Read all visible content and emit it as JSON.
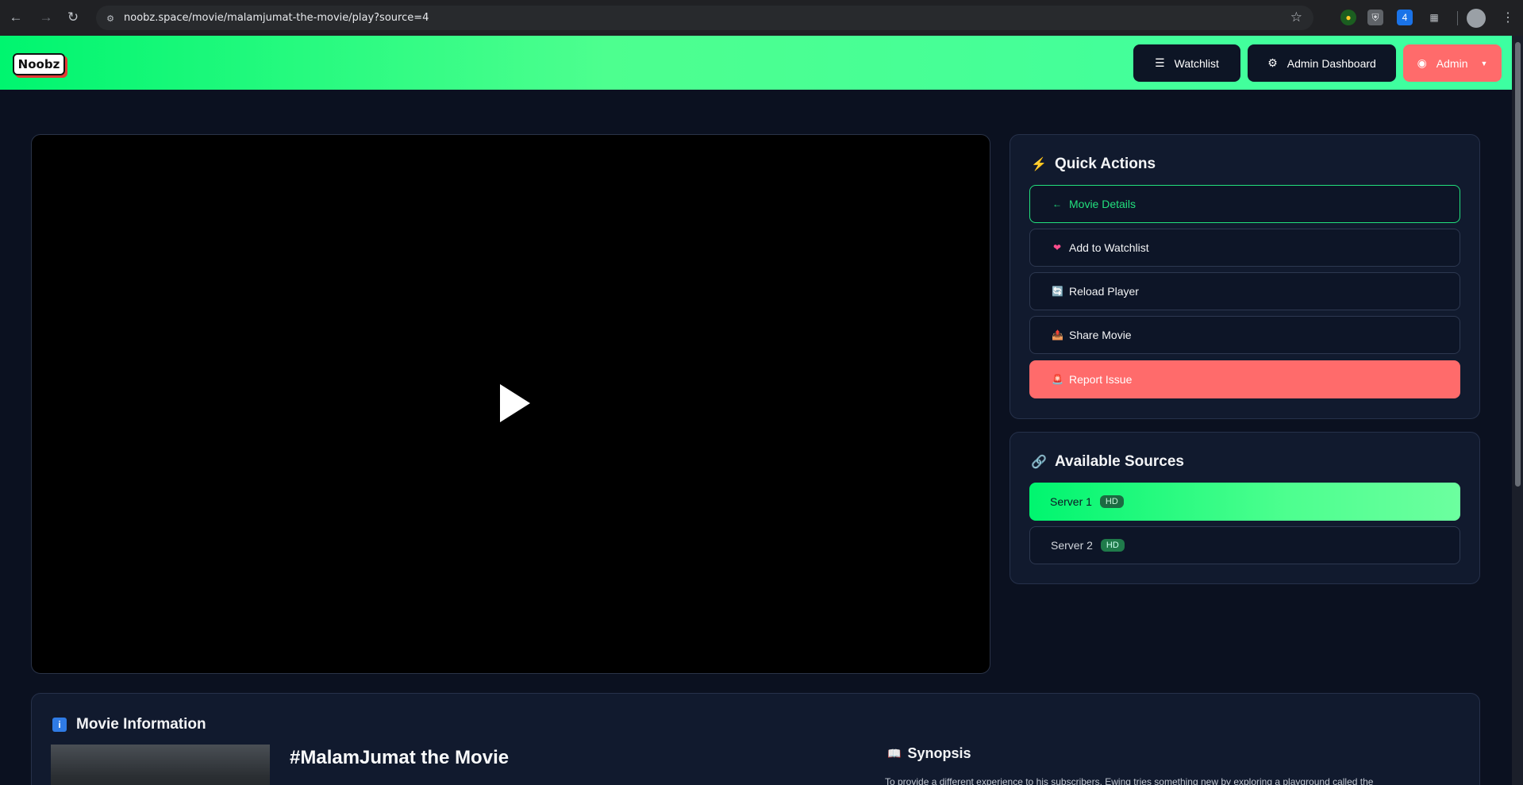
{
  "browser": {
    "url": "noobz.space/movie/malamjumat-the-movie/play?source=4",
    "extension_badge": "4"
  },
  "header": {
    "logo_text": "Noobz",
    "watchlist_label": "Watchlist",
    "admin_dashboard_label": "Admin Dashboard",
    "admin_menu_label": "Admin"
  },
  "quick_actions": {
    "title": "Quick Actions",
    "items": [
      {
        "icon": "←",
        "label": "Movie Details"
      },
      {
        "icon": "❤",
        "label": "Add to Watchlist"
      },
      {
        "icon": "🔄",
        "label": "Reload Player"
      },
      {
        "icon": "📤",
        "label": "Share Movie"
      },
      {
        "icon": "🚨",
        "label": "Report Issue"
      }
    ]
  },
  "sources": {
    "title": "Available Sources",
    "items": [
      {
        "label": "Server 1",
        "badge": "HD",
        "active": true
      },
      {
        "label": "Server 2",
        "badge": "HD",
        "active": false
      }
    ]
  },
  "movie_info": {
    "section_title": "Movie Information",
    "title": "#MalamJumat the Movie",
    "synopsis_title": "Synopsis",
    "synopsis_text": "To provide a different experience to his subscribers, Ewing tries something new by exploring a playground called the"
  },
  "colors": {
    "accent_green": "#00f56f",
    "danger": "#ff6b6b",
    "bg": "#0b1120",
    "panel": "#111a2e"
  }
}
